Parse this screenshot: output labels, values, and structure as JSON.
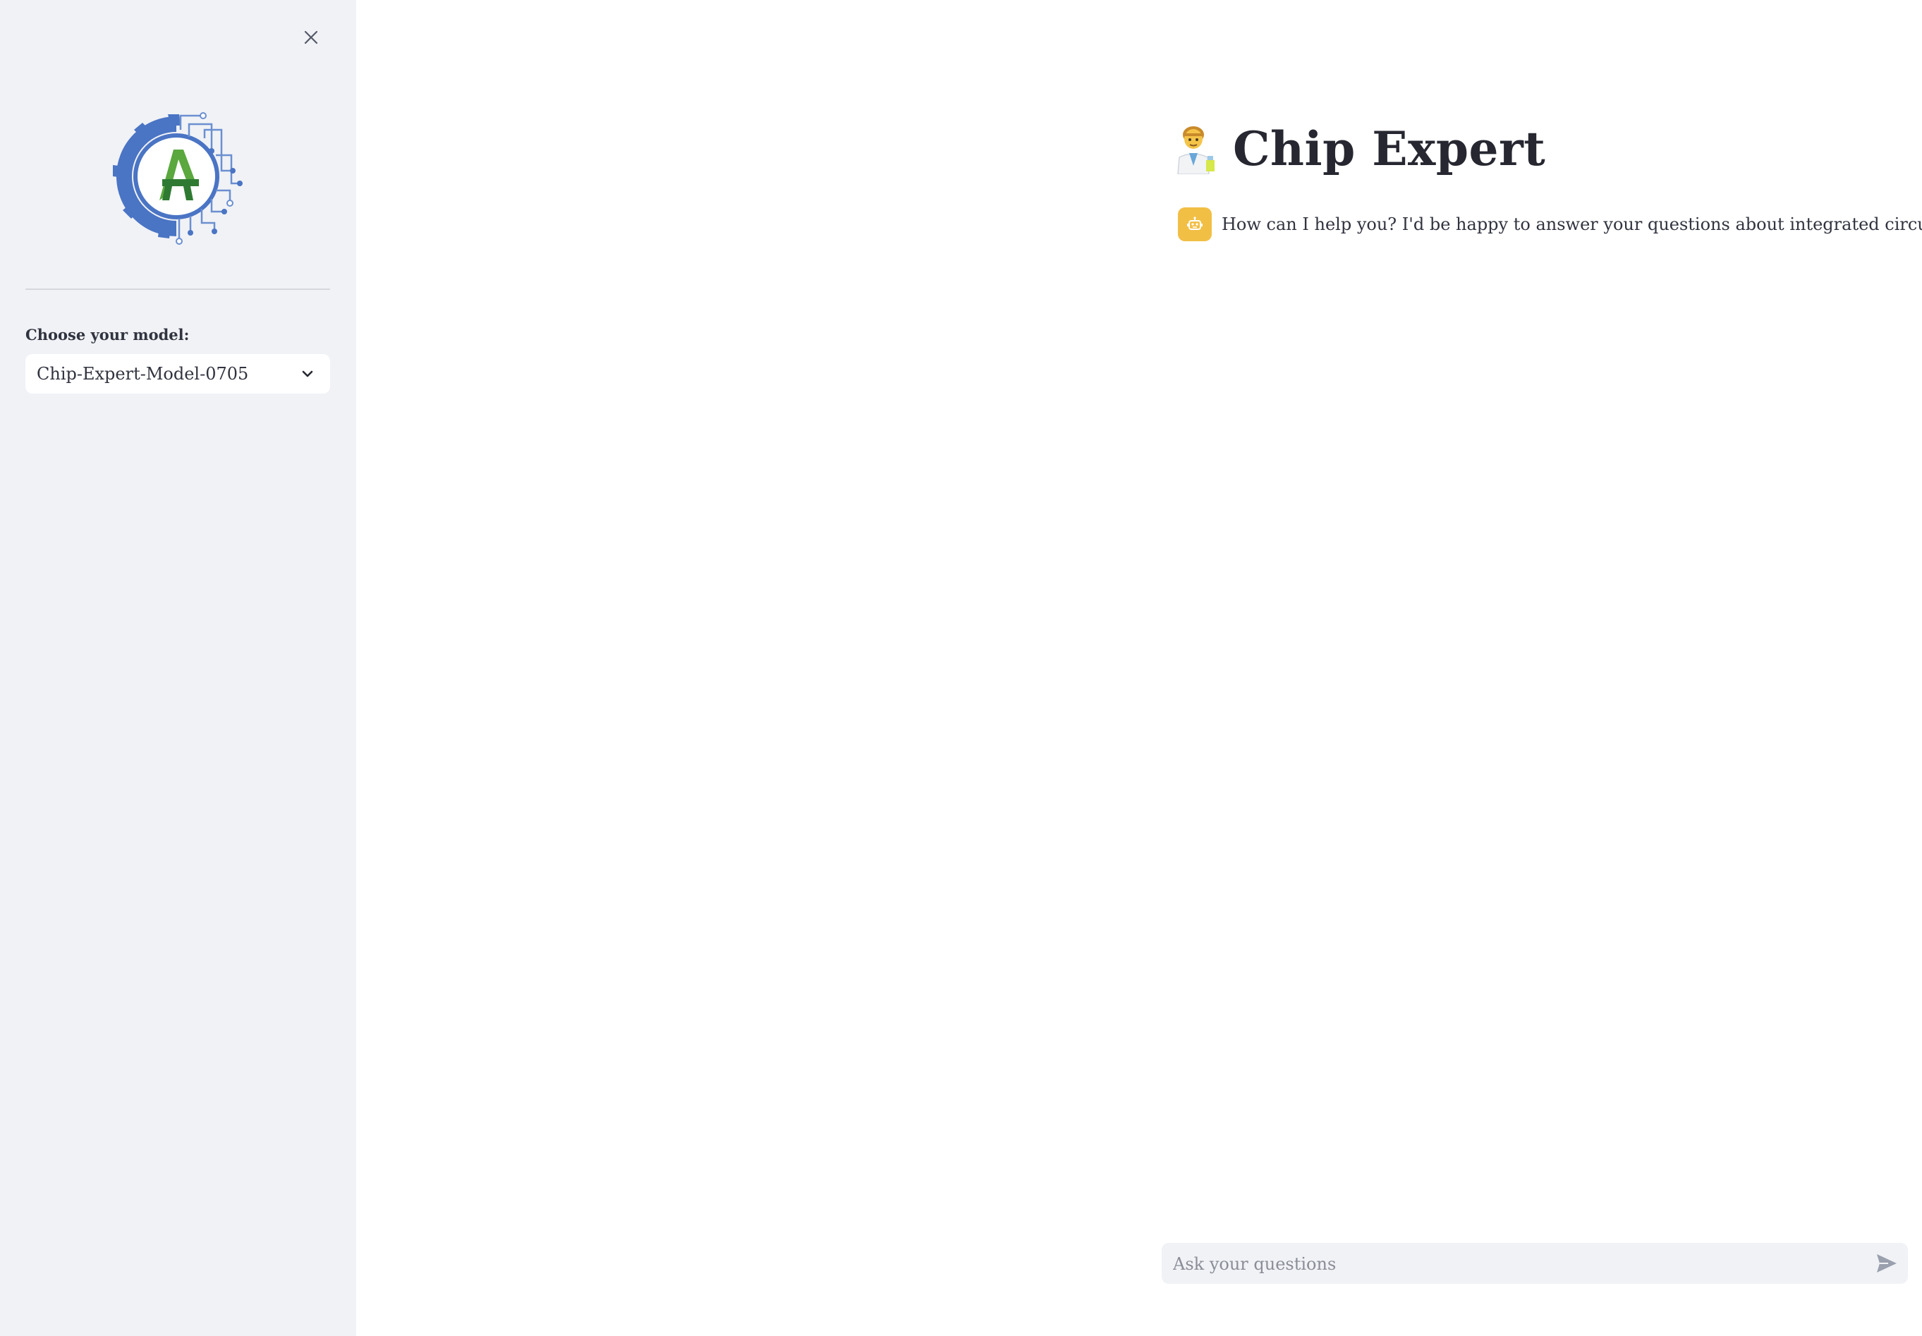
{
  "sidebar": {
    "close_icon": "close-icon",
    "logo_text": "A",
    "model_label": "Choose your model:",
    "model_selected": "Chip-Expert-Model-0705",
    "dropdown_icon": "chevron-down-icon"
  },
  "main": {
    "title_icon": "scientist-emoji",
    "title": "Chip Expert",
    "messages": [
      {
        "role": "assistant",
        "avatar_icon": "robot-icon",
        "text": "How can I help you? I'd be happy to answer your questions about integrated circuit."
      }
    ],
    "chat_input": {
      "placeholder": "Ask your questions",
      "value": "",
      "send_icon": "send-icon"
    }
  },
  "colors": {
    "sidebar_bg": "#f0f2f6",
    "avatar_bg": "#f2bf45",
    "logo_blue": "#4a74c4",
    "logo_green": "#3c9a3a"
  }
}
